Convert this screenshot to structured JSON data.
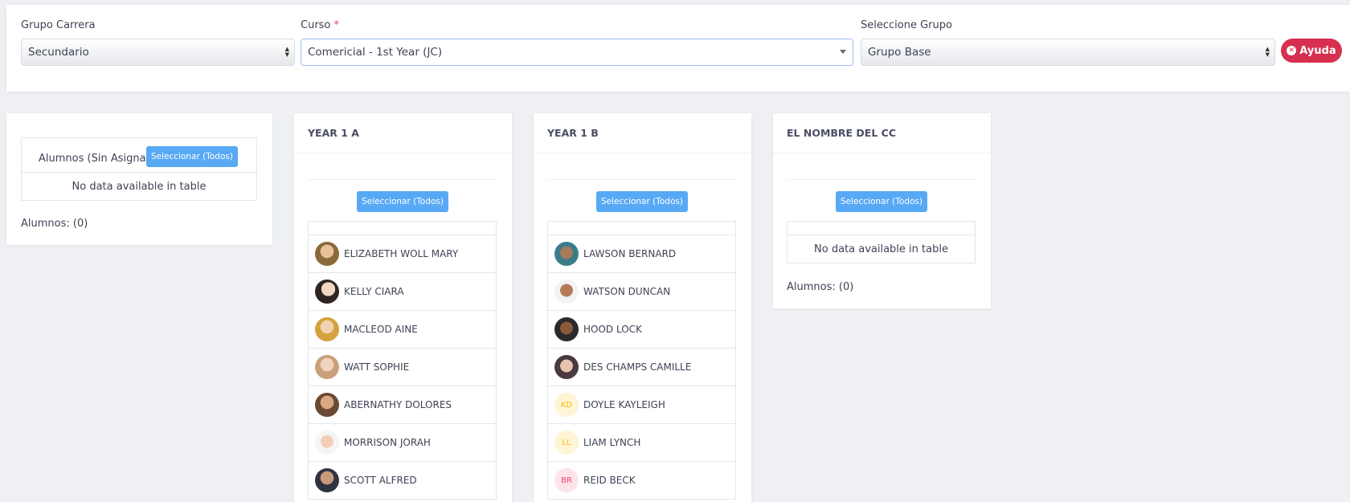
{
  "filters": {
    "grupo_carrera": {
      "label": "Grupo Carrera",
      "value": "Secundario"
    },
    "curso": {
      "label": "Curso",
      "required_mark": "*",
      "value": "Comericial - 1st Year (JC)"
    },
    "grupo": {
      "label": "Seleccione Grupo",
      "value": "Grupo Base"
    },
    "help_label": "Ayuda"
  },
  "unassigned": {
    "title": "Alumnos (Sin Asignar)",
    "select_all": "Seleccionar (Todos)",
    "empty": "No data available in table",
    "count": "Alumnos: (0)"
  },
  "groups": [
    {
      "title": "YEAR 1 A",
      "select_all": "Seleccionar (Todos)",
      "students": [
        {
          "name": "ELIZABETH WOLL MARY",
          "avatar": "photo-avatar"
        },
        {
          "name": "KELLY CIARA",
          "avatar": "photo-avatar"
        },
        {
          "name": "MACLEOD AINE",
          "avatar": "photo-avatar"
        },
        {
          "name": "WATT SOPHIE",
          "avatar": "photo-avatar"
        },
        {
          "name": "ABERNATHY DOLORES",
          "avatar": "photo-avatar"
        },
        {
          "name": "MORRISON JORAH",
          "avatar": "photo-avatar"
        },
        {
          "name": "SCOTT ALFRED",
          "avatar": "photo-avatar"
        }
      ]
    },
    {
      "title": "YEAR 1 B",
      "select_all": "Seleccionar (Todos)",
      "students": [
        {
          "name": "LAWSON BERNARD",
          "avatar": "photo-avatar"
        },
        {
          "name": "WATSON DUNCAN",
          "avatar": "photo-avatar"
        },
        {
          "name": "HOOD LOCK",
          "avatar": "photo-avatar"
        },
        {
          "name": "DES CHAMPS CAMILLE",
          "avatar": "photo-avatar"
        },
        {
          "name": "DOYLE KAYLEIGH",
          "initials": "KD"
        },
        {
          "name": "LIAM LYNCH",
          "initials": "LL"
        },
        {
          "name": "REID BECK",
          "initials": "BR"
        }
      ]
    },
    {
      "title": "EL NOMBRE DEL CC",
      "select_all": "Seleccionar (Todos)",
      "empty": "No data available in table",
      "count": "Alumnos: (0)"
    }
  ],
  "colors": {
    "accent": "#58a9f5",
    "danger": "#d62f4f",
    "initials_kd": "#f6c000",
    "initials_ll": "#f6c000",
    "initials_br": "#f1416c"
  }
}
